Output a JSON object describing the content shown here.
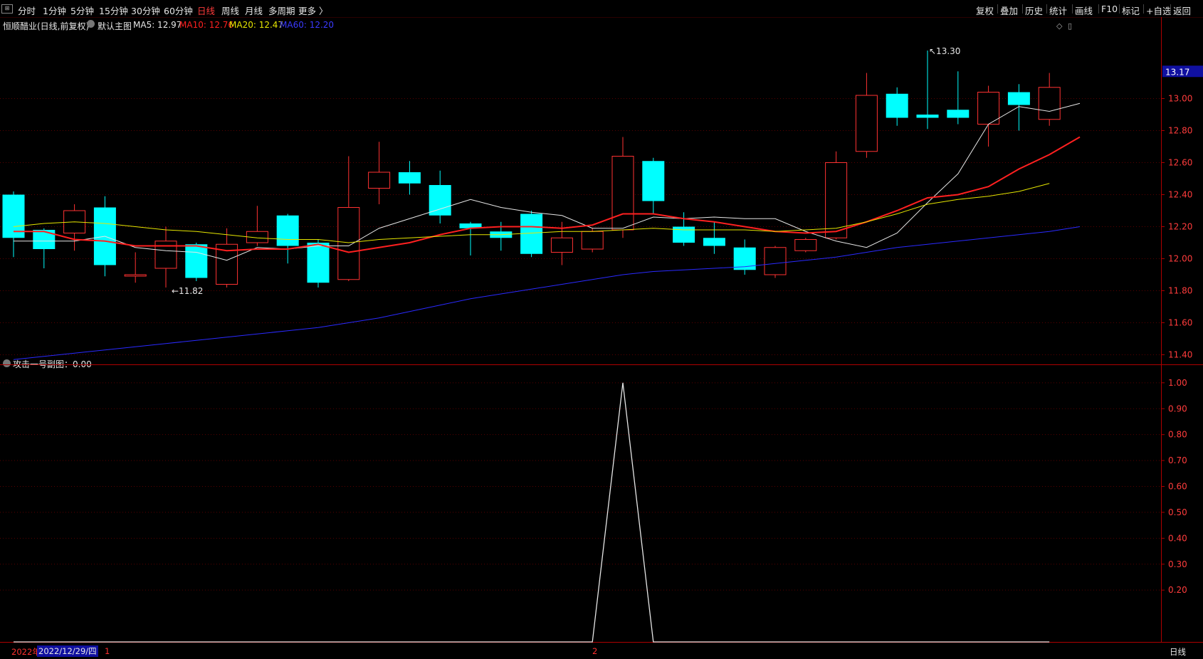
{
  "toolbar": {
    "left": [
      "分时",
      "1分钟",
      "5分钟",
      "15分钟",
      "30分钟",
      "60分钟",
      "日线",
      "周线",
      "月线",
      "多周期",
      "更多 〉"
    ],
    "active": "日线",
    "right": [
      "复权",
      "叠加",
      "历史",
      "统计",
      "画线",
      "F10",
      "标记",
      "+自选",
      "返回"
    ]
  },
  "main_legend": {
    "stock": "恒顺醋业(日线,前复权)",
    "template": "默认主图",
    "ma5": "MA5: 12.97",
    "ma10": "MA10: 12.76",
    "ma20": "MA20: 12.47",
    "ma60": "MA60: 12.20"
  },
  "sub_legend": "攻击一号副图：0.00",
  "price_tag": "13.17",
  "bottom": {
    "year": "2022年",
    "date": "2022/12/29/四",
    "month_mark_1": "1",
    "month_mark_2": "2",
    "period": "日线"
  },
  "colors": {
    "up": "#ff3232",
    "down": "#00ffff",
    "ma5": "#e6e6e6",
    "ma10": "#ff2020",
    "ma20": "#e6e600",
    "ma60": "#2a2aff",
    "axis": "#b00000"
  },
  "chart_data": [
    {
      "type": "candlestick",
      "title": "恒顺醋业(日线,前复权)",
      "ylim": [
        11.34,
        13.42
      ],
      "yticks": [
        11.4,
        11.6,
        11.8,
        12.0,
        12.2,
        12.4,
        12.6,
        12.8,
        13.0
      ],
      "annotations": [
        {
          "label": "11.82",
          "index": 5
        },
        {
          "label": "13.30",
          "index": 30
        }
      ],
      "candles": [
        {
          "o": 12.4,
          "c": 12.13,
          "h": 12.42,
          "l": 12.01
        },
        {
          "o": 12.18,
          "c": 12.06,
          "h": 12.19,
          "l": 11.94
        },
        {
          "o": 12.16,
          "c": 12.3,
          "h": 12.34,
          "l": 12.05
        },
        {
          "o": 12.32,
          "c": 11.96,
          "h": 12.39,
          "l": 11.89
        },
        {
          "o": 11.9,
          "c": 11.9,
          "h": 12.04,
          "l": 11.85
        },
        {
          "o": 11.94,
          "c": 12.11,
          "h": 12.2,
          "l": 11.82
        },
        {
          "o": 12.09,
          "c": 11.88,
          "h": 12.1,
          "l": 11.86
        },
        {
          "o": 11.84,
          "c": 12.09,
          "h": 12.19,
          "l": 11.82
        },
        {
          "o": 12.1,
          "c": 12.17,
          "h": 12.33,
          "l": 12.08
        },
        {
          "o": 12.27,
          "c": 12.08,
          "h": 12.28,
          "l": 11.97
        },
        {
          "o": 12.1,
          "c": 11.85,
          "h": 12.12,
          "l": 11.82
        },
        {
          "o": 11.87,
          "c": 12.32,
          "h": 12.64,
          "l": 11.86
        },
        {
          "o": 12.44,
          "c": 12.54,
          "h": 12.73,
          "l": 12.34
        },
        {
          "o": 12.54,
          "c": 12.47,
          "h": 12.61,
          "l": 12.4
        },
        {
          "o": 12.46,
          "c": 12.27,
          "h": 12.55,
          "l": 12.22
        },
        {
          "o": 12.22,
          "c": 12.19,
          "h": 12.23,
          "l": 12.02
        },
        {
          "o": 12.17,
          "c": 12.13,
          "h": 12.23,
          "l": 12.05
        },
        {
          "o": 12.28,
          "c": 12.03,
          "h": 12.3,
          "l": 12.01
        },
        {
          "o": 12.04,
          "c": 12.13,
          "h": 12.23,
          "l": 11.96
        },
        {
          "o": 12.06,
          "c": 12.17,
          "h": 12.19,
          "l": 12.04
        },
        {
          "o": 12.18,
          "c": 12.64,
          "h": 12.76,
          "l": 12.13
        },
        {
          "o": 12.61,
          "c": 12.36,
          "h": 12.63,
          "l": 12.28
        },
        {
          "o": 12.2,
          "c": 12.1,
          "h": 12.29,
          "l": 12.08
        },
        {
          "o": 12.13,
          "c": 12.08,
          "h": 12.23,
          "l": 12.03
        },
        {
          "o": 12.07,
          "c": 11.93,
          "h": 12.12,
          "l": 11.9
        },
        {
          "o": 11.9,
          "c": 12.07,
          "h": 12.08,
          "l": 11.88
        },
        {
          "o": 12.05,
          "c": 12.12,
          "h": 12.13,
          "l": 12.04
        },
        {
          "o": 12.13,
          "c": 12.6,
          "h": 12.67,
          "l": 12.12
        },
        {
          "o": 12.67,
          "c": 13.02,
          "h": 13.16,
          "l": 12.63
        },
        {
          "o": 13.03,
          "c": 12.88,
          "h": 13.07,
          "l": 12.83
        },
        {
          "o": 12.9,
          "c": 12.88,
          "h": 13.3,
          "l": 12.81
        },
        {
          "o": 12.93,
          "c": 12.88,
          "h": 13.17,
          "l": 12.84
        },
        {
          "o": 12.84,
          "c": 13.04,
          "h": 13.08,
          "l": 12.7
        },
        {
          "o": 13.04,
          "c": 12.96,
          "h": 13.09,
          "l": 12.8
        },
        {
          "o": 12.87,
          "c": 13.07,
          "h": 13.16,
          "l": 12.83
        }
      ],
      "series": [
        {
          "name": "MA5",
          "values": [
            12.11,
            12.11,
            12.11,
            12.14,
            12.07,
            12.05,
            12.04,
            11.99,
            12.07,
            12.06,
            12.08,
            12.08,
            12.19,
            12.25,
            12.31,
            12.37,
            12.32,
            12.29,
            12.27,
            12.19,
            12.19,
            12.26,
            12.25,
            12.26,
            12.25,
            12.25,
            12.17,
            12.11,
            12.07,
            12.16,
            12.35,
            12.53,
            12.84,
            12.95,
            12.92,
            12.97
          ]
        },
        {
          "name": "MA10",
          "values": [
            12.17,
            12.17,
            12.12,
            12.11,
            12.08,
            12.08,
            12.08,
            12.05,
            12.06,
            12.06,
            12.09,
            12.04,
            12.07,
            12.1,
            12.15,
            12.19,
            12.2,
            12.2,
            12.19,
            12.21,
            12.28,
            12.28,
            12.25,
            12.23,
            12.2,
            12.17,
            12.16,
            12.17,
            12.23,
            12.3,
            12.38,
            12.4,
            12.45,
            12.56,
            12.65,
            12.76
          ]
        },
        {
          "name": "MA20",
          "values": [
            12.2,
            12.22,
            12.23,
            12.22,
            12.2,
            12.18,
            12.17,
            12.15,
            12.13,
            12.12,
            12.12,
            12.1,
            12.12,
            12.13,
            12.14,
            12.15,
            12.15,
            12.16,
            12.17,
            12.17,
            12.18,
            12.19,
            12.18,
            12.18,
            12.18,
            12.17,
            12.18,
            12.19,
            12.23,
            12.28,
            12.34,
            12.37,
            12.39,
            12.42,
            12.47
          ]
        },
        {
          "name": "MA60",
          "values": [
            11.37,
            11.39,
            11.41,
            11.43,
            11.45,
            11.47,
            11.49,
            11.51,
            11.53,
            11.55,
            11.57,
            11.6,
            11.63,
            11.67,
            11.71,
            11.75,
            11.78,
            11.81,
            11.84,
            11.87,
            11.9,
            11.92,
            11.93,
            11.94,
            11.95,
            11.97,
            11.99,
            12.01,
            12.04,
            12.07,
            12.09,
            12.11,
            12.13,
            12.15,
            12.17,
            12.2
          ]
        }
      ]
    },
    {
      "type": "line",
      "title": "攻击一号副图",
      "ylim": [
        0.0,
        1.06
      ],
      "yticks": [
        0.2,
        0.3,
        0.4,
        0.5,
        0.6,
        0.7,
        0.8,
        0.9,
        1.0
      ],
      "series": [
        {
          "name": "攻击一号副图",
          "values": [
            0,
            0,
            0,
            0,
            0,
            0,
            0,
            0,
            0,
            0,
            0,
            0,
            0,
            0,
            0,
            0,
            0,
            0,
            0,
            0,
            1,
            0,
            0,
            0,
            0,
            0,
            0,
            0,
            0,
            0,
            0,
            0,
            0,
            0,
            0
          ]
        }
      ]
    }
  ]
}
